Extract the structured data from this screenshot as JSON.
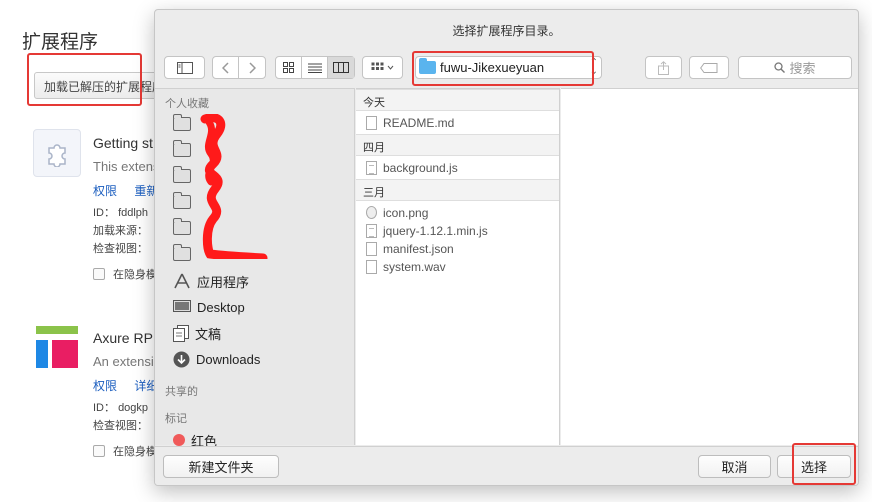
{
  "background_page": {
    "title": "扩展程序",
    "load_unpacked_button": "加载已解压的扩展程序",
    "extensions": [
      {
        "name": "Getting st",
        "description": "This extens",
        "links": [
          "权限",
          "重新"
        ],
        "id_label": "ID：",
        "id_value": "fddlph",
        "source_label": "加载来源：",
        "views_label": "检查视图：",
        "incognito_label": "在隐身模"
      },
      {
        "name": "Axure RP",
        "description": "An extensi",
        "links": [
          "权限",
          "详细"
        ],
        "id_label": "ID：",
        "id_value": "dogkp",
        "views_label": "检查视图：",
        "incognito_label": "在隐身模"
      }
    ]
  },
  "dialog": {
    "title": "选择扩展程序目录。",
    "location": "fuwu-Jikexueyuan",
    "search_placeholder": "搜索",
    "sidebar": {
      "favorites_header": "个人收藏",
      "favorites": [
        {
          "label": "应用程序",
          "icon": "apps-icon"
        },
        {
          "label": "Desktop",
          "icon": "desktop-icon"
        },
        {
          "label": "文稿",
          "icon": "documents-icon"
        },
        {
          "label": "Downloads",
          "icon": "downloads-icon"
        }
      ],
      "shared_header": "共享的",
      "tags_header": "标记",
      "tags": [
        {
          "label": "红色",
          "color": "#f05a5a"
        }
      ]
    },
    "groups": [
      {
        "header": "今天",
        "files": [
          {
            "name": "README.md",
            "icon": "document-icon"
          }
        ]
      },
      {
        "header": "四月",
        "files": [
          {
            "name": "background.js",
            "icon": "script-icon"
          }
        ]
      },
      {
        "header": "三月",
        "files": [
          {
            "name": "icon.png",
            "icon": "image-icon"
          },
          {
            "name": "jquery-1.12.1.min.js",
            "icon": "script-icon"
          },
          {
            "name": "manifest.json",
            "icon": "document-icon"
          },
          {
            "name": "system.wav",
            "icon": "audio-icon"
          }
        ]
      }
    ],
    "buttons": {
      "new_folder": "新建文件夹",
      "cancel": "取消",
      "choose": "选择"
    }
  },
  "colors": {
    "annotation_red": "#e53935",
    "folder_blue": "#5ab4ee",
    "link_blue": "#1a5dbf"
  }
}
